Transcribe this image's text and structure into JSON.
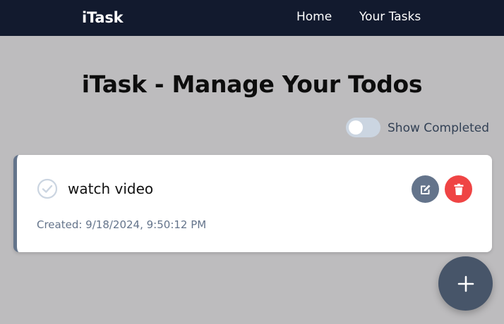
{
  "navbar": {
    "brand": "iTask",
    "links": [
      "Home",
      "Your Tasks"
    ]
  },
  "page": {
    "title": "iTask - Manage Your Todos"
  },
  "filter": {
    "toggle_label": "Show Completed",
    "show_completed": false
  },
  "tasks": [
    {
      "title": "watch video",
      "created": "Created: 9/18/2024, 9:50:12 PM",
      "completed": false
    }
  ],
  "icons": {
    "check": "check-circle-icon",
    "edit": "edit-icon",
    "delete": "trash-icon",
    "add": "plus-icon"
  },
  "colors": {
    "navbar_bg": "#121a2e",
    "page_bg": "#bdbcbe",
    "edit_button": "#64748b",
    "delete_button": "#ef4444",
    "fab": "#475569"
  }
}
